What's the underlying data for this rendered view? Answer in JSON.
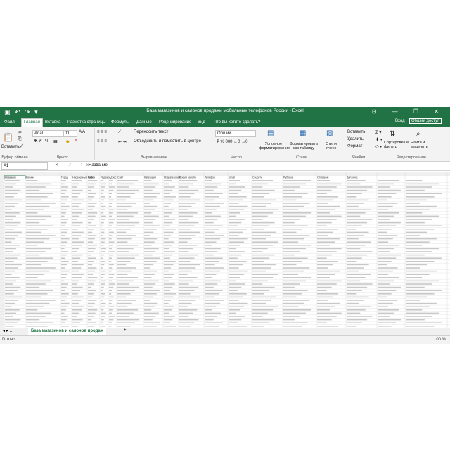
{
  "window": {
    "title": "База магазинов и салонов продажи мобильных телефонов России - Excel",
    "controls": [
      "—",
      "❐",
      "✕"
    ]
  },
  "ribbon_tabs": [
    "Файл",
    "Главная",
    "Вставка",
    "Разметка страницы",
    "Формулы",
    "Данные",
    "Рецензирование",
    "Вид",
    "Что вы хотите сделать?"
  ],
  "account": {
    "signin": "Вход",
    "share": "Общий доступ"
  },
  "ribbon": {
    "paste": "Вставить",
    "font_name": "Arial",
    "font_size": "11",
    "wrap_text": "Переносить текст",
    "merge": "Объединить и поместить в центре",
    "number_format": "Общий",
    "cond_format": "Условное форматирование",
    "format_table": "Форматировать как таблицу",
    "cell_styles": "Стили ячеек",
    "insert": "Вставить",
    "delete": "Удалить",
    "format": "Формат",
    "sort_filter": "Сортировка и фильтр",
    "find_select": "Найти и выделить",
    "groups": {
      "clipboard": "Буфер обмена",
      "font": "Шрифт",
      "alignment": "Выравнивание",
      "number": "Число",
      "styles": "Стили",
      "cells": "Ячейки",
      "editing": "Редактирование"
    }
  },
  "formula_bar": {
    "name_box": "A1",
    "fx": "✕ ✓ fx",
    "value": "Название"
  },
  "sheet": {
    "tab": "База магазинов и салонов продаж",
    "add": "+",
    "header": [
      "Название",
      "Регион",
      "Город",
      "Населенный пункт",
      "Район",
      "Индекс",
      "Адрес",
      "Сайт",
      "Категория",
      "Подкатегория",
      "Время работы",
      "Телефон",
      "Email",
      "Соцсети",
      "Рубрика",
      "Описание",
      "Доп. инф."
    ]
  },
  "status": {
    "ready": "Готово",
    "zoom": "100 %"
  }
}
